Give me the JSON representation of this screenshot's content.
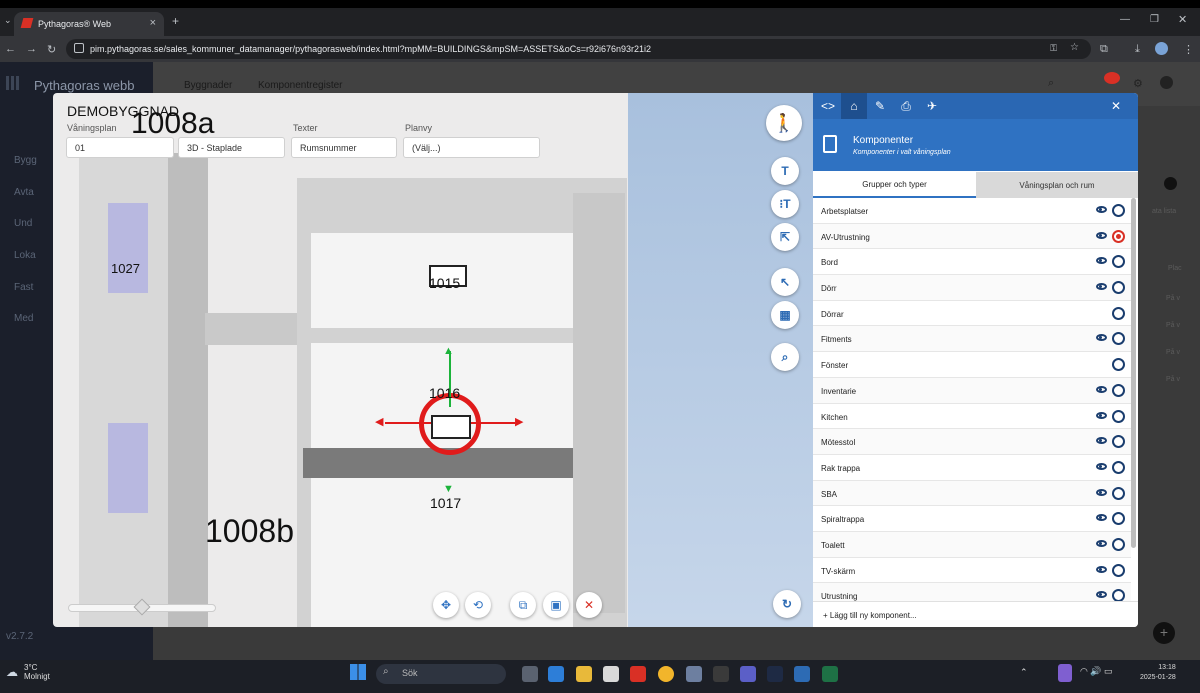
{
  "browser": {
    "tab_title": "Pythagoras® Web",
    "url": "pim.pythagoras.se/sales_kommuner_datamanager/pythagorasweb/index.html?mpMM=BUILDINGS&mpSM=ASSETS&oCs=r92i676n93r21i2"
  },
  "app": {
    "title": "Pythagoras webb",
    "version": "v2.7.2",
    "nav_items": [
      "Bygg",
      "Avta",
      "Und",
      "Loka",
      "Fast",
      "Med"
    ],
    "header_links": [
      "Byggnader",
      "Komponentregister"
    ]
  },
  "viewer": {
    "building_name": "DEMOBYGGNAD",
    "big_room_top": "1008a",
    "big_room_bottom": "1008b",
    "rooms": [
      "1027",
      "1015",
      "1016",
      "1017"
    ],
    "dropdowns": [
      {
        "label": "Våningsplan",
        "value": "01"
      },
      {
        "label": "",
        "value": "3D - Staplade"
      },
      {
        "label": "Texter",
        "value": "Rumsnummer"
      },
      {
        "label": "Planvy",
        "value": "(Välj...)"
      }
    ]
  },
  "panel": {
    "title": "Komponenter",
    "subtitle": "Komponenter i valt våningsplan",
    "tab_groups": "Grupper och typer",
    "tab_floors": "Våningsplan och rum",
    "add_label": "+ Lägg till ny komponent...",
    "items": [
      {
        "name": "Arbetsplatser",
        "eye": true,
        "selected": false
      },
      {
        "name": "AV-Utrustning",
        "eye": true,
        "selected": true
      },
      {
        "name": "Bord",
        "eye": true,
        "selected": false
      },
      {
        "name": "Dörr",
        "eye": true,
        "selected": false
      },
      {
        "name": "Dörrar",
        "eye": false,
        "selected": false
      },
      {
        "name": "Fitments",
        "eye": true,
        "selected": false
      },
      {
        "name": "Fönster",
        "eye": false,
        "selected": false
      },
      {
        "name": "Inventarie",
        "eye": true,
        "selected": false
      },
      {
        "name": "Kitchen",
        "eye": true,
        "selected": false
      },
      {
        "name": "Mötesstol",
        "eye": true,
        "selected": false
      },
      {
        "name": "Rak trappa",
        "eye": true,
        "selected": false
      },
      {
        "name": "SBA",
        "eye": true,
        "selected": false
      },
      {
        "name": "Spiraltrappa",
        "eye": true,
        "selected": false
      },
      {
        "name": "Toalett",
        "eye": true,
        "selected": false
      },
      {
        "name": "TV-skärm",
        "eye": true,
        "selected": false
      },
      {
        "name": "Utrustning",
        "eye": true,
        "selected": false
      }
    ]
  },
  "background_page": {
    "lista": "ata lista",
    "plac": "Plac",
    "pa": "På v"
  },
  "taskbar": {
    "temp": "3°C",
    "weather": "Molnigt",
    "search": "Sök",
    "time": "13:18",
    "date": "2025-01-28"
  },
  "colors": {
    "accent": "#2f72c2",
    "selected": "#d93025"
  }
}
